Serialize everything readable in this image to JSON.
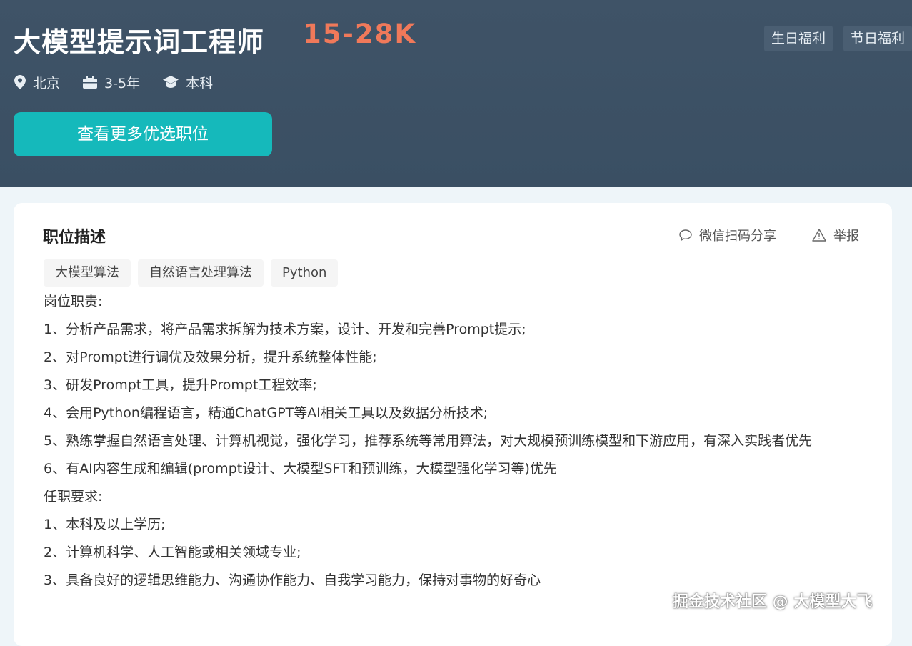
{
  "job": {
    "title": "大模型提示词工程师",
    "salary": "15-28K",
    "welfare": [
      "生日福利",
      "节日福利"
    ],
    "location": "北京",
    "experience": "3-5年",
    "education": "本科",
    "cta_label": "查看更多优选职位"
  },
  "card": {
    "title": "职位描述",
    "share_label": "微信扫码分享",
    "report_label": "举报",
    "tags": [
      "大模型算法",
      "自然语言处理算法",
      "Python"
    ],
    "lines": [
      "岗位职责:",
      "1、分析产品需求，将产品需求拆解为技术方案，设计、开发和完善Prompt提示;",
      "2、对Prompt进行调优及效果分析，提升系统整体性能;",
      "3、研发Prompt工具，提升Prompt工程效率;",
      "4、会用Python编程语言，精通ChatGPT等AI相关工具以及数据分析技术;",
      "5、熟练掌握自然语言处理、计算机视觉，强化学习，推荐系统等常用算法，对大规模预训练模型和下游应用，有深入实践者优先",
      "6、有AI内容生成和编辑(prompt设计、大模型SFT和预训练，大模型强化学习等)优先",
      "任职要求:",
      "1、本科及以上学历;",
      "2、计算机科学、人工智能或相关领域专业;",
      "3、具备良好的逻辑思维能力、沟通协作能力、自我学习能力，保持对事物的好奇心"
    ]
  },
  "watermark": "掘金技术社区 @ 大模型大飞",
  "colors": {
    "header_bg": "#3f5367",
    "salary": "#f0795a",
    "cta_bg": "#15b9bb"
  },
  "icons": {
    "location": "location-pin-icon",
    "experience": "briefcase-icon",
    "education": "graduation-cap-icon",
    "share": "chat-bubble-icon",
    "report": "warning-icon"
  }
}
